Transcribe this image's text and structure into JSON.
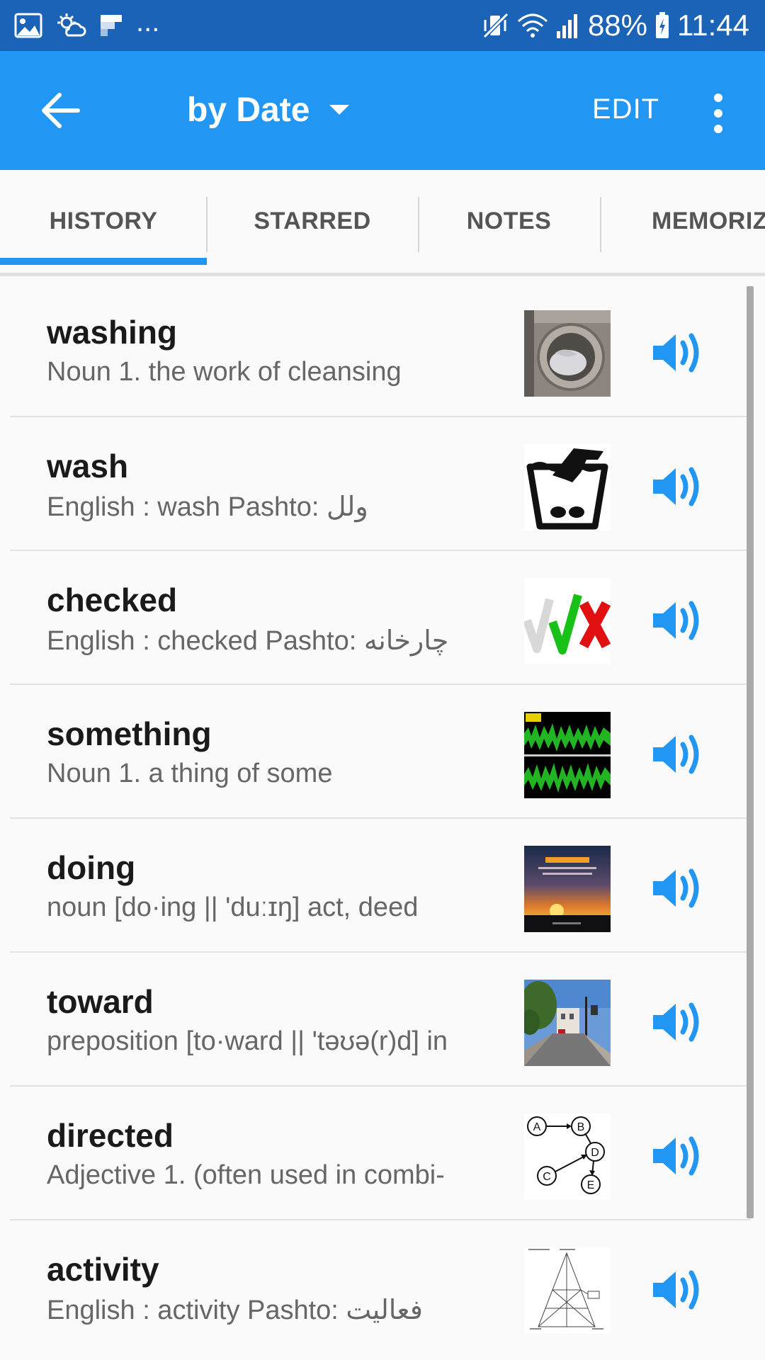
{
  "status_bar": {
    "left_icons": [
      "gallery-icon",
      "weather-icon",
      "flipboard-icon"
    ],
    "more_indicator": "...",
    "right_icons": [
      "mute-vibrate-icon",
      "wifi-icon",
      "signal-icon"
    ],
    "battery_percent": "88%",
    "time": "11:44"
  },
  "app_bar": {
    "back_icon": "arrow-back-icon",
    "sort_label": "by Date",
    "edit_label": "EDIT",
    "more_icon": "more-vertical-icon",
    "color": "#2196f3"
  },
  "tabs": [
    {
      "label": "HISTORY",
      "selected": true
    },
    {
      "label": "STARRED",
      "selected": false
    },
    {
      "label": "NOTES",
      "selected": false
    },
    {
      "label": "MEMORIZ",
      "selected": false
    }
  ],
  "entries": [
    {
      "word": "washing",
      "definition": "Noun 1. the work of cleansing",
      "image": "washing-machine-photo"
    },
    {
      "word": "wash",
      "definition": "English : wash Pashto: ولل",
      "image": "hand-wash-symbol"
    },
    {
      "word": "checked",
      "definition": "English : checked Pashto: چارخانه",
      "image": "check-marks-image"
    },
    {
      "word": "something",
      "definition": "Noun 1. a thing of some",
      "image": "audio-waveform-image"
    },
    {
      "word": "doing",
      "definition": "noun [do·ing || 'duːɪŋ] act, deed",
      "image": "sunset-poster-image"
    },
    {
      "word": "toward",
      "definition": "preposition [to·ward || 'təʊə(r)d] in",
      "image": "street-photo"
    },
    {
      "word": "directed",
      "definition": "Adjective 1. (often used in combi-",
      "image": "directed-graph-diagram"
    },
    {
      "word": "activity",
      "definition": "English : activity Pashto: فعالیت",
      "image": "activity-diagram"
    }
  ],
  "speaker_icon": "speaker-icon"
}
